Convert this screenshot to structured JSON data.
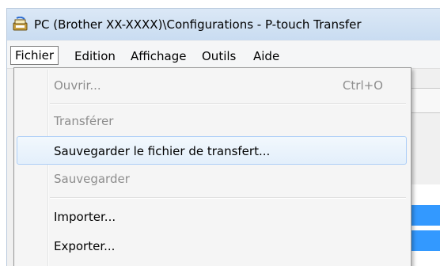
{
  "window": {
    "title": "PC (Brother  XX-XXXX)\\Configurations - P-touch Transfer"
  },
  "menubar": {
    "items": [
      {
        "label": "Fichier"
      },
      {
        "label": "Edition"
      },
      {
        "label": "Affichage"
      },
      {
        "label": "Outils"
      },
      {
        "label": "Aide"
      }
    ]
  },
  "file_menu": {
    "items": [
      {
        "label": "Ouvrir...",
        "shortcut": "Ctrl+O",
        "enabled": false
      },
      {
        "label": "Transférer",
        "enabled": false
      },
      {
        "label": "Sauvegarder le fichier de transfert...",
        "enabled": true,
        "highlighted": true
      },
      {
        "label": "Sauvegarder",
        "enabled": false
      },
      {
        "label": "Importer...",
        "enabled": true
      },
      {
        "label": "Exporter...",
        "enabled": true
      }
    ]
  },
  "colors": {
    "highlight_border": "#aecff7",
    "selection_blue": "#3399ff",
    "disabled_text": "#8d8d8d"
  },
  "icons": {
    "app": "p-touch-transfer-icon"
  }
}
